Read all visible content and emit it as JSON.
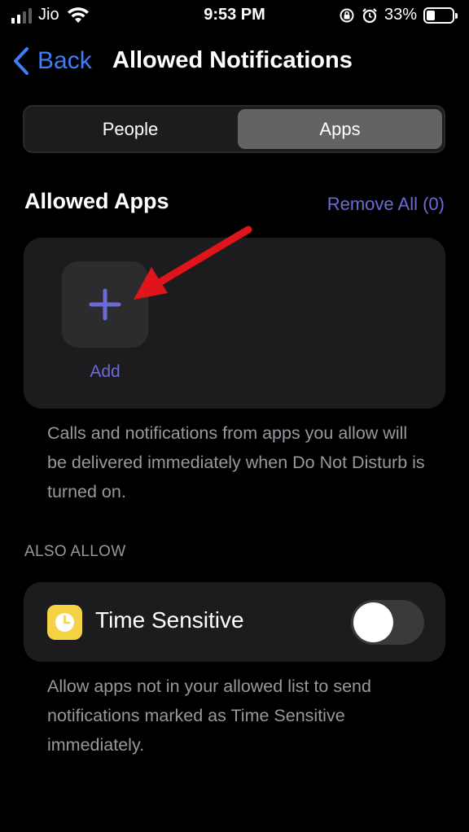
{
  "status_bar": {
    "carrier": "Jio",
    "time": "9:53 PM",
    "battery_percent": "33%",
    "battery_level": 0.33,
    "signal_bars_active": 2,
    "signal_bars_total": 4,
    "icons": [
      "signal-icon",
      "wifi-icon",
      "orientation-lock-icon",
      "alarm-icon",
      "battery-icon"
    ]
  },
  "nav": {
    "back_label": "Back",
    "title": "Allowed Notifications",
    "accent_color": "#3e7ef6"
  },
  "segmented_control": {
    "options": [
      "People",
      "Apps"
    ],
    "selected": "Apps"
  },
  "allowed_apps": {
    "title": "Allowed Apps",
    "remove_all_label": "Remove All (0)",
    "add_label": "Add",
    "accent_color": "#6b6bd6",
    "description": "Calls and notifications from apps you allow will be delivered immediately when Do Not Disturb is turned on."
  },
  "also_allow": {
    "header": "ALSO ALLOW",
    "time_sensitive": {
      "label": "Time Sensitive",
      "enabled": false,
      "icon": "clock-icon",
      "icon_color": "#f5d146"
    },
    "description": "Allow apps not in your allowed list to send notifications marked as Time Sensitive immediately."
  },
  "annotation": {
    "arrow_color": "#e0141b"
  }
}
